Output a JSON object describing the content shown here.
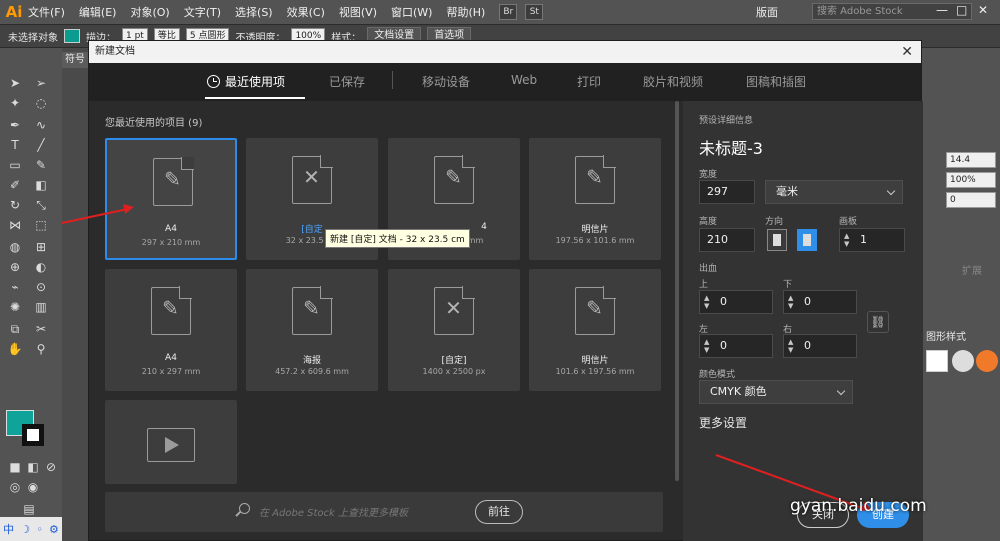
{
  "app": {
    "logo": "Ai",
    "menus": [
      "文件(F)",
      "编辑(E)",
      "对象(O)",
      "文字(T)",
      "选择(S)",
      "效果(C)",
      "视图(V)",
      "窗口(W)",
      "帮助(H)"
    ],
    "bridge_icons": [
      "Br",
      "St"
    ],
    "workspace": "版面",
    "stock_search_placeholder": "搜索 Adobe Stock",
    "window_controls": [
      "—",
      "□",
      "✕"
    ]
  },
  "controlbar": {
    "selection": "未选择对象",
    "stroke_label": "描边：",
    "stroke_value": "1 pt",
    "uniform": "等比",
    "brush": "5 点圆形",
    "opacity_label": "不透明度：",
    "opacity_value": "100%",
    "style_label": "样式：",
    "doc_setup": "文档设置",
    "preferences": "首选项"
  },
  "canvas": {
    "doc_tab": "符号"
  },
  "rightpanel": {
    "fields": [
      "14.4",
      "100%",
      "0"
    ],
    "expand": "扩展",
    "graphic_styles": "图形样式"
  },
  "dialog": {
    "title": "新建文档",
    "close": "✕",
    "tabs": [
      "最近使用项",
      "已保存",
      "移动设备",
      "Web",
      "打印",
      "胶片和视频",
      "图稿和插图"
    ],
    "recent_title": "您最近使用的项目 (9)",
    "tiles": [
      {
        "name": "A4",
        "size": "297 x 210 mm",
        "glyph": "✎",
        "selected": true
      },
      {
        "name": "[自定",
        "size": "32 x 23.5 cm",
        "glyph": "✕"
      },
      {
        "name": "4",
        "size": "297 x 210 mm",
        "glyph": "✎"
      },
      {
        "name": "明信片",
        "size": "197.56 x 101.6 mm",
        "glyph": "✎"
      },
      {
        "name": "A4",
        "size": "210 x 297 mm",
        "glyph": "✎"
      },
      {
        "name": "海报",
        "size": "457.2 x 609.6 mm",
        "glyph": "✎"
      },
      {
        "name": "[自定]",
        "size": "1400 x 2500 px",
        "glyph": "✕"
      },
      {
        "name": "明信片",
        "size": "101.6 x 197.56 mm",
        "glyph": "✎"
      },
      {
        "name": "",
        "size": "",
        "glyph": ""
      }
    ],
    "tooltip": "新建 [自定] 文档 - 32 x 23.5 cm",
    "stock_placeholder": "在 Adobe Stock 上查找更多模板",
    "goto": "前往",
    "details": {
      "heading": "预设详细信息",
      "doc_name": "未标题-3",
      "width_label": "宽度",
      "width_value": "297",
      "unit": "毫米",
      "height_label": "高度",
      "height_value": "210",
      "orientation_label": "方向",
      "artboards_label": "画板",
      "artboards_value": "1",
      "bleed_label": "出血",
      "top_label": "上",
      "bottom_label": "下",
      "left_label": "左",
      "right_label": "右",
      "bleed_top": "0",
      "bleed_bottom": "0",
      "bleed_left": "0",
      "bleed_right": "0",
      "color_mode_label": "颜色模式",
      "color_mode": "CMYK 颜色",
      "more_settings": "更多设置",
      "close_btn": "关闭",
      "create_btn": "创建"
    }
  },
  "watermark": "gyan.baidu.com",
  "statusbar": [
    "中",
    "☽",
    "◦",
    "⚙"
  ],
  "colors": {
    "accent": "#2f8fe8",
    "fill_swatch": "#0fa39a",
    "arrow": "#e02020"
  }
}
